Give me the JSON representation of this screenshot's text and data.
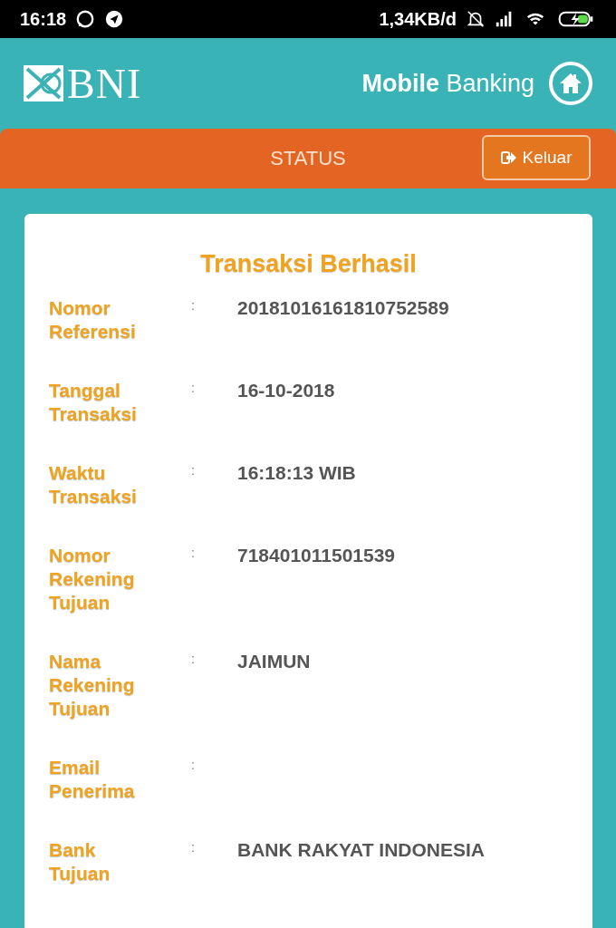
{
  "status_bar": {
    "time": "16:18",
    "speed": "1,34KB/d"
  },
  "header": {
    "brand": "BNI",
    "title_bold": "Mobile",
    "title_rest": "Banking"
  },
  "nav": {
    "title": "STATUS",
    "logout": "Keluar"
  },
  "card": {
    "title": "Transaksi Berhasil",
    "rows": [
      {
        "label": "Nomor Referensi",
        "sep": ":",
        "value": "20181016161810752589"
      },
      {
        "label": "Tanggal Transaksi",
        "sep": ":",
        "value": "16-10-2018"
      },
      {
        "label": "Waktu Transaksi",
        "sep": ":",
        "value": "16:18:13 WIB"
      },
      {
        "label": "Nomor Rekening Tujuan",
        "sep": ":",
        "value": "718401011501539"
      },
      {
        "label": "Nama Rekening Tujuan",
        "sep": ":",
        "value": "JAIMUN"
      },
      {
        "label": "Email Penerima",
        "sep": ":"
      },
      {
        "label": "Bank Tujuan",
        "sep": ":",
        "value": "BANK RAKYAT INDONESIA"
      }
    ]
  }
}
